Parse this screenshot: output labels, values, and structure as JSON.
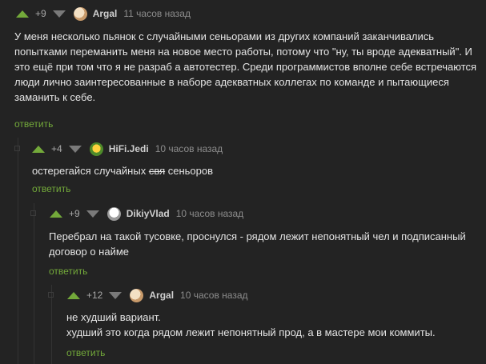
{
  "comments": [
    {
      "rating": "+9",
      "user": "Argal",
      "time": "11 часов назад",
      "lines": [
        "У меня несколько пьянок с случайными сеньорами из других компаний заканчивались",
        "попытками переманить меня на новое место работы, потому что \"ну, ты вроде адекватный\". И",
        "это ещё при том что я не разраб а автотестер. Среди программистов вполне себе встречаются",
        "люди лично заинтересованные в наборе адекватных коллегах по команде и пытающиеся",
        "заманить к себе."
      ],
      "reply": "ответить"
    },
    {
      "rating": "+4",
      "user": "HiFi.Jedi",
      "time": "10 часов назад",
      "text_before": "остерегайся случайных ",
      "text_struck": "свя",
      "text_after": " сеньоров",
      "reply": "ответить"
    },
    {
      "rating": "+9",
      "user": "DikiyVlad",
      "time": "10 часов назад",
      "lines": [
        "Перебрал на такой тусовке, проснулся - рядом лежит непонятный чел и подписанный",
        "договор о найме"
      ],
      "reply": "ответить"
    },
    {
      "rating": "+12",
      "user": "Argal",
      "time": "10 часов назад",
      "lines": [
        "не худший вариант.",
        "худший это когда рядом лежит непонятный прод, а в мастере мои коммиты."
      ],
      "reply": "ответить"
    }
  ],
  "colors": {
    "background": "#232323",
    "accent": "#73a93a",
    "downvote": "#7a7a7a"
  }
}
